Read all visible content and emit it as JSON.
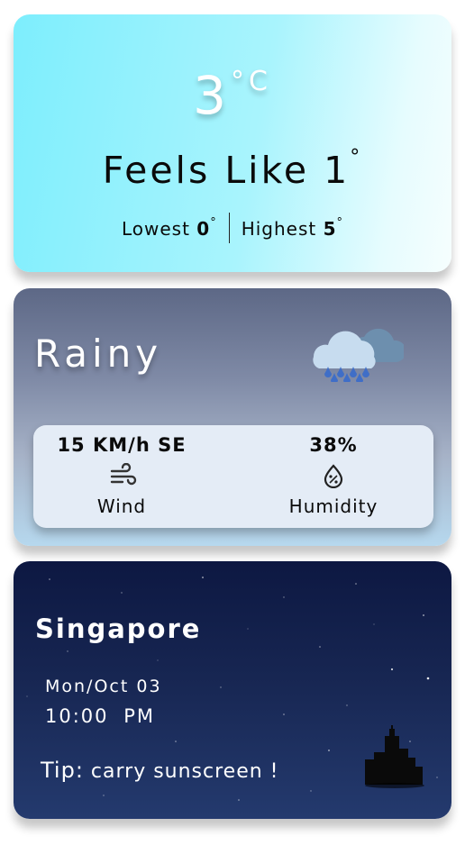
{
  "temperature": {
    "current": "3",
    "unit": "°C",
    "feels_like_label": "Feels Like",
    "feels_like_value": "1",
    "degree_symbol": "°",
    "lowest_label": "Lowest",
    "lowest_value": "0",
    "highest_label": "Highest",
    "highest_value": "5"
  },
  "condition": {
    "title": "Rainy",
    "icon": "rain-cloud-icon",
    "wind_value": "15 KM/h SE",
    "wind_label": "Wind",
    "wind_icon": "wind-icon",
    "humidity_value": "38%",
    "humidity_label": "Humidity",
    "humidity_icon": "humidity-drop-icon"
  },
  "location": {
    "city": "Singapore",
    "date": "Mon/Oct 03",
    "time": "10:00 PM",
    "tip_label": "Tip:",
    "tip_text": " carry sunscreen !",
    "icon": "city-skyline-icon"
  },
  "colors": {
    "temp_card_start": "#7deefd",
    "condition_card_top": "#5d6886",
    "location_card_bg": "#0d1842"
  }
}
